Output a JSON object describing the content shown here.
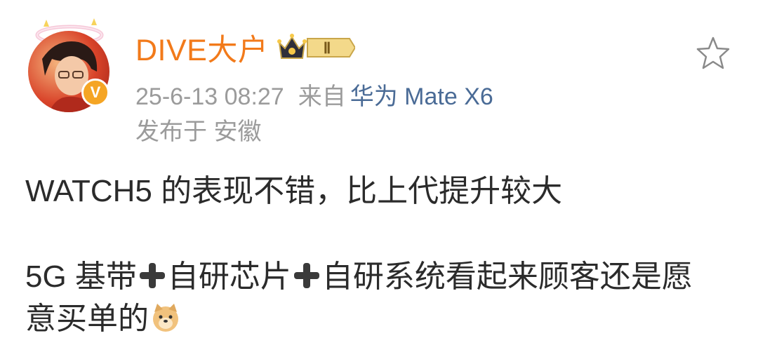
{
  "author": {
    "name": "DIVE大户",
    "vip_label": "V",
    "rank_label": "Ⅱ"
  },
  "meta": {
    "timestamp": "25-6-13 08:27",
    "from_label": "来自",
    "device": "华为 Mate X6",
    "location": "发布于 安徽"
  },
  "post": {
    "line1": "WATCH5 的表现不错，比上代提升较大",
    "line2_part1": "5G 基带",
    "line2_part2": "自研芯片",
    "line2_part3": "自研系统看起来顾客还是愿",
    "line3": "意买单的"
  },
  "icons": {
    "favorite": "star-outline-icon",
    "plus": "heavy-plus-icon",
    "emoji": "doge-emoji-icon"
  },
  "colors": {
    "username": "#f27a1a",
    "device_link": "#4a6b96",
    "meta_text": "#9b9b9b",
    "vip": "#f5a524"
  }
}
